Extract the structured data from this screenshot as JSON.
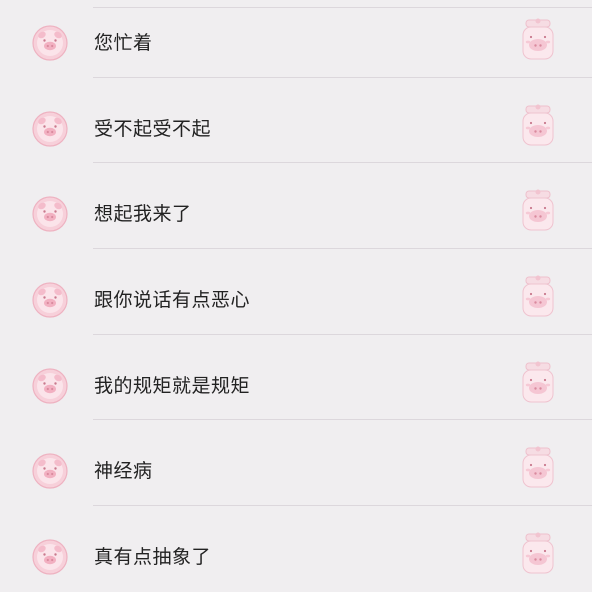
{
  "list": {
    "items": [
      {
        "label": "您忙着",
        "avatar_icon": "pink-pig-face-icon",
        "thumbnail_icon": "pink-pig-jar-sticker-icon"
      },
      {
        "label": "受不起受不起",
        "avatar_icon": "pink-pig-face-icon",
        "thumbnail_icon": "pink-pig-jar-sticker-icon"
      },
      {
        "label": "想起我来了",
        "avatar_icon": "pink-pig-face-icon",
        "thumbnail_icon": "pink-pig-jar-sticker-icon"
      },
      {
        "label": "跟你说话有点恶心",
        "avatar_icon": "pink-pig-face-icon",
        "thumbnail_icon": "pink-pig-jar-sticker-icon"
      },
      {
        "label": "我的规矩就是规矩",
        "avatar_icon": "pink-pig-face-icon",
        "thumbnail_icon": "pink-pig-jar-sticker-icon"
      },
      {
        "label": "神经病",
        "avatar_icon": "pink-pig-face-icon",
        "thumbnail_icon": "pink-pig-jar-sticker-icon"
      },
      {
        "label": "真有点抽象了",
        "avatar_icon": "pink-pig-face-icon",
        "thumbnail_icon": "pink-pig-jar-sticker-icon"
      }
    ]
  },
  "colors": {
    "background": "#f0eef0",
    "divider": "#dcd7dc",
    "text": "#222222",
    "accent_pink": "#f2b8c6"
  }
}
